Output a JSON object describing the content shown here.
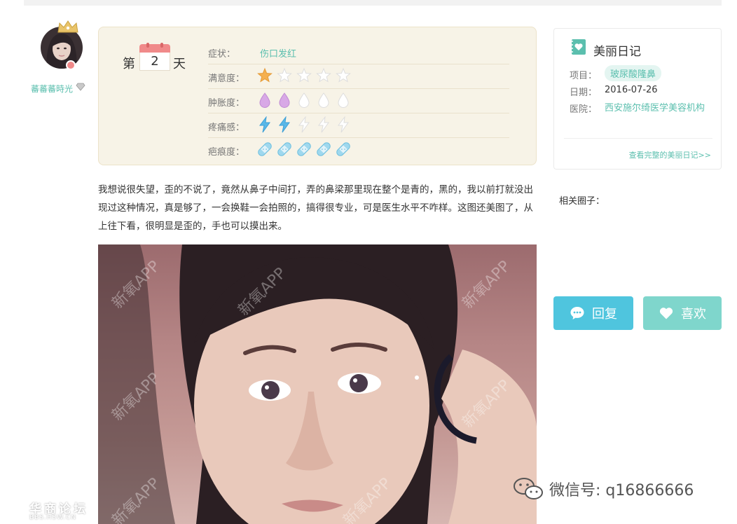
{
  "user": {
    "name": "蕃蕃蕃時光",
    "avatar": "avatar",
    "crown_icon": "crown-icon",
    "badge_icon": "gem-icon"
  },
  "day_card": {
    "day_prefix": "第",
    "day_number": "2",
    "day_suffix": "天",
    "rows": [
      {
        "label": "症状：",
        "value": "伤口发红"
      },
      {
        "label": "满意度：",
        "icon": "star-icon",
        "filled": 1,
        "total": 5
      },
      {
        "label": "肿胀度：",
        "icon": "droplet-icon",
        "filled": 2,
        "total": 5
      },
      {
        "label": "疼痛感：",
        "icon": "lightning-icon",
        "filled": 2,
        "total": 5
      },
      {
        "label": "疤痕度：",
        "icon": "bandage-icon",
        "filled": 5,
        "total": 5
      }
    ],
    "colors": {
      "star": "#f5b04f",
      "droplet": "#d8a8e6",
      "lightning": "#5ab8e8",
      "bandage": "#9fd8ee",
      "empty": "#ffffff"
    }
  },
  "post": {
    "text": "我想说很失望，歪的不说了，竟然从鼻子中间打，弄的鼻梁那里现在整个是青的，黑的，我以前打就没出现过这种情况，真是够了，一会换鞋一会拍照的，搞得很专业，可是医生水平不咋样。这图还美图了，从上往下看，很明显是歪的，手也可以摸出来。",
    "photo_watermark": "新氧APP"
  },
  "diary_card": {
    "title": "美丽日记",
    "title_icon": "heart-diary-icon",
    "project_label": "项目：",
    "project_value": "玻尿酸隆鼻",
    "date_label": "日期：",
    "date_value": "2016-07-26",
    "hospital_label": "医院：",
    "hospital_value": "西安施尔绮医学美容机构",
    "full_link": "查看完整的美丽日记>>"
  },
  "related_label": "相关圈子：",
  "buttons": {
    "reply": "回复",
    "like": "喜欢"
  },
  "overlay": {
    "wechat": "微信号: q16866666",
    "forum_cn": "华商论坛",
    "forum_url": "BBS.HSW.CN"
  },
  "colors": {
    "accent": "#5bbfae",
    "reply_btn": "#4fc5de",
    "like_btn": "#7fd6cc",
    "card_bg": "#f7f3e7"
  }
}
